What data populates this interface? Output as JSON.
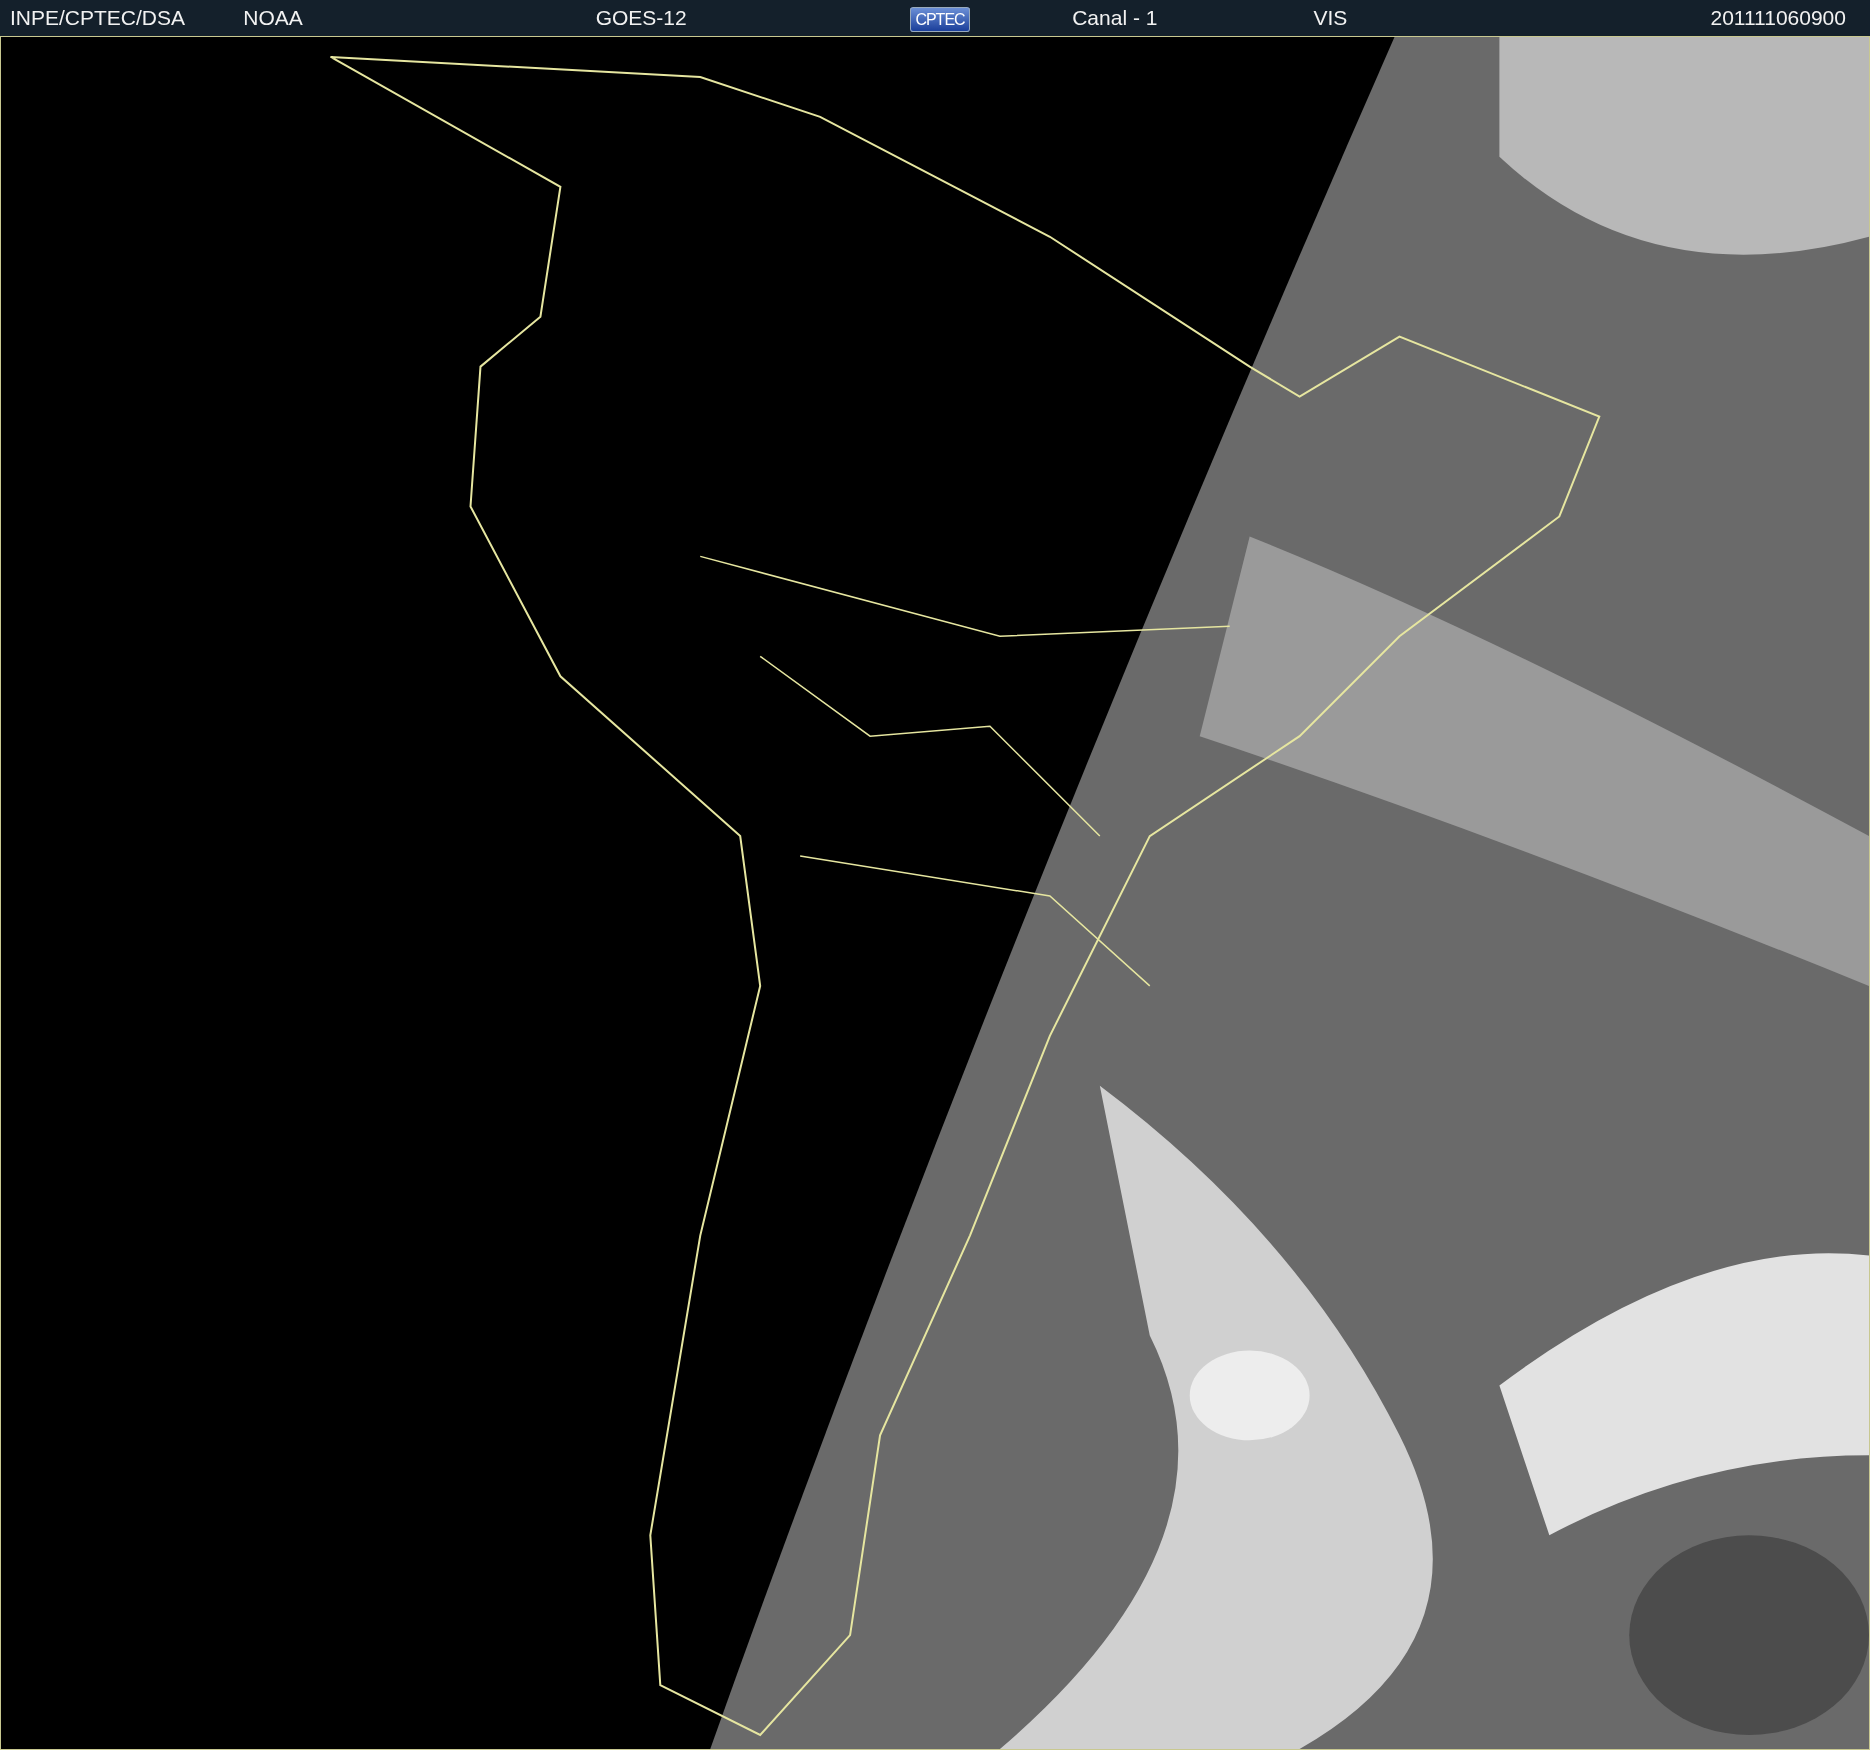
{
  "header": {
    "items": [
      {
        "kind": "text",
        "text": "INPE/CPTEC/DSA"
      },
      {
        "kind": "text",
        "text": "NOAA"
      },
      {
        "kind": "text",
        "text": "GOES-12"
      },
      {
        "kind": "logo",
        "text": "CPTEC"
      },
      {
        "kind": "text",
        "text": "Canal - 1"
      },
      {
        "kind": "text",
        "text": "VIS"
      },
      {
        "kind": "text",
        "text": "201111060900"
      }
    ]
  }
}
